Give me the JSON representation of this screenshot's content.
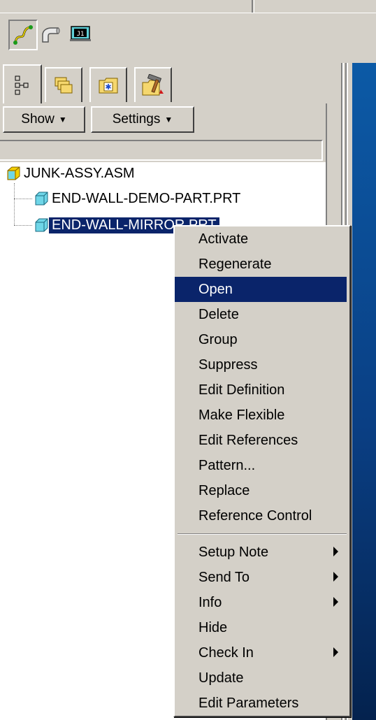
{
  "toolbar": {
    "icons": [
      "curve-icon",
      "pipe-icon",
      "j1-icon"
    ],
    "j1_text": "J1"
  },
  "tabs": [
    "model-tree-tab",
    "folder-browser-tab",
    "favorites-tab",
    "connections-tab"
  ],
  "panel": {
    "show_label": "Show",
    "settings_label": "Settings"
  },
  "tree": {
    "root": "JUNK-ASSY.ASM",
    "children": [
      "END-WALL-DEMO-PART.PRT",
      "END-WALL-MIRROR.PRT"
    ],
    "selected_index": 1
  },
  "context_menu": {
    "items": [
      {
        "label": "Activate"
      },
      {
        "label": "Regenerate"
      },
      {
        "label": "Open"
      },
      {
        "label": "Delete"
      },
      {
        "label": "Group"
      },
      {
        "label": "Suppress"
      },
      {
        "label": "Edit Definition"
      },
      {
        "label": "Make Flexible"
      },
      {
        "label": "Edit References"
      },
      {
        "label": "Pattern..."
      },
      {
        "label": "Replace"
      },
      {
        "label": "Reference Control"
      },
      {
        "label": "Setup Note"
      },
      {
        "label": "Send To"
      },
      {
        "label": "Info"
      },
      {
        "label": "Hide"
      },
      {
        "label": "Check In"
      },
      {
        "label": "Update"
      },
      {
        "label": "Edit Parameters"
      }
    ],
    "highlighted": "Open",
    "submenu_items": [
      "Setup Note",
      "Send To",
      "Info",
      "Check In"
    ]
  },
  "colors": {
    "selection": "#0a246a",
    "face": "#d4d0c8",
    "graphics_bg": "#0a3f84"
  }
}
